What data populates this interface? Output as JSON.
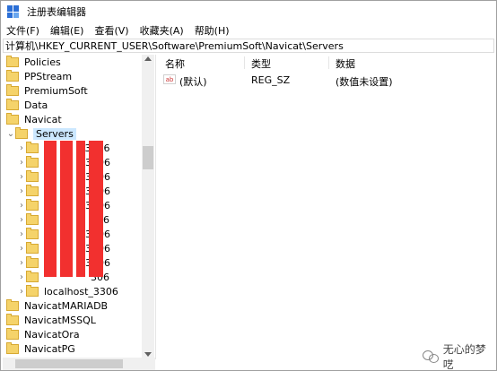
{
  "window": {
    "title": "注册表编辑器",
    "app_icon": "registry-editor-icon"
  },
  "menu": [
    "文件(F)",
    "编辑(E)",
    "查看(V)",
    "收藏夹(A)",
    "帮助(H)"
  ],
  "address": "计算机\\HKEY_CURRENT_USER\\Software\\PremiumSoft\\Navicat\\Servers",
  "tree": {
    "items": [
      {
        "label": "Policies"
      },
      {
        "label": "PPStream"
      },
      {
        "label": "PremiumSoft"
      },
      {
        "label": "Data"
      },
      {
        "label": "Navicat"
      },
      {
        "label": "Servers"
      },
      {
        "label": "_3306"
      },
      {
        "label": "3306"
      },
      {
        "label": "3306"
      },
      {
        "label": "3306"
      },
      {
        "label": "3306"
      },
      {
        "label": "306"
      },
      {
        "label": "3306"
      },
      {
        "label": "3306"
      },
      {
        "label": "3306"
      },
      {
        "label": "306"
      },
      {
        "label": "localhost_3306"
      },
      {
        "label": "NavicatMARIADB"
      },
      {
        "label": "NavicatMSSQL"
      },
      {
        "label": "NavicatOra"
      },
      {
        "label": "NavicatPG"
      }
    ]
  },
  "list": {
    "columns": [
      "名称",
      "类型",
      "数据"
    ],
    "rows": [
      {
        "name": "(默认)",
        "type": "REG_SZ",
        "data": "(数值未设置)"
      }
    ]
  },
  "watermark": "无心的梦呓"
}
